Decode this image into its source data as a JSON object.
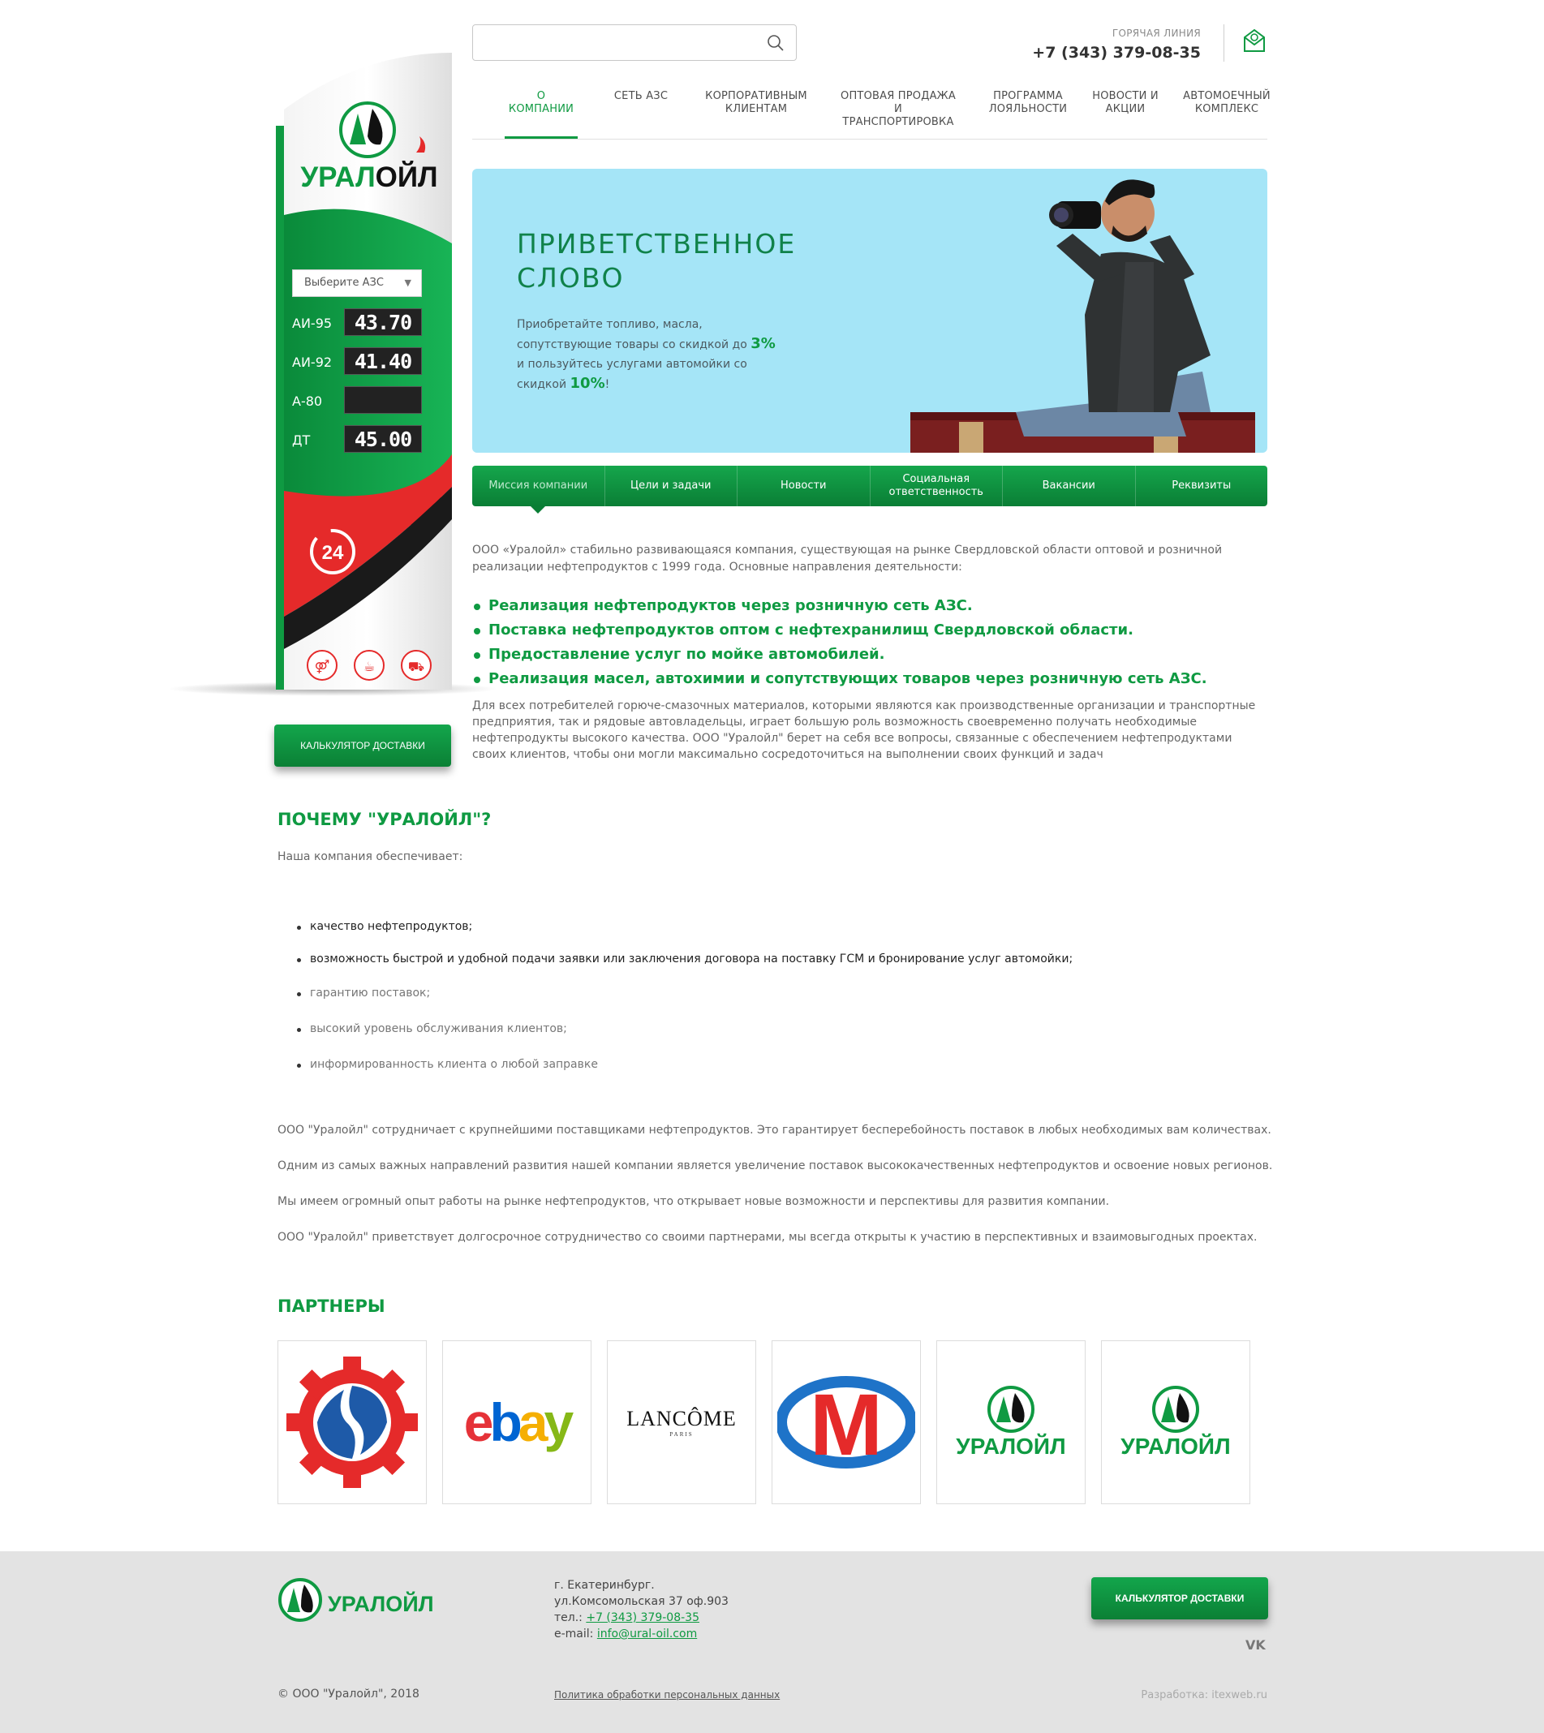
{
  "header": {
    "search_placeholder": "",
    "hotline_label": "ГОРЯЧАЯ ЛИНИЯ",
    "hotline_phone": "+7 (343) 379-08-35"
  },
  "nav": {
    "items": [
      {
        "label": "О КОМПАНИИ"
      },
      {
        "label": "СЕТЬ АЗС"
      },
      {
        "label": "КОРПОРАТИВНЫМ КЛИЕНТАМ"
      },
      {
        "label": "ОПТОВАЯ ПРОДАЖА И ТРАНСПОРТИРОВКА"
      },
      {
        "label": "ПРОГРАММА ЛОЯЛЬНОСТИ"
      },
      {
        "label": "НОВОСТИ И АКЦИИ"
      },
      {
        "label": "АВТОМОЕЧНЫЙ КОМПЛЕКС"
      }
    ]
  },
  "stela": {
    "brand": "УРАЛОЙЛ",
    "select_placeholder": "Выберите АЗС",
    "fuels": [
      {
        "name": "АИ-95",
        "price": "43.70"
      },
      {
        "name": "АИ-92",
        "price": "41.40"
      },
      {
        "name": "А-80",
        "price": ""
      },
      {
        "name": "ДТ",
        "price": "45.00"
      }
    ],
    "badge_24": "24",
    "calc_button": "КАЛЬКУЛЯТОР ДОСТАВКИ"
  },
  "hero": {
    "title_line1": "ПРИВЕТСТВЕННОЕ",
    "title_line2": "СЛОВО",
    "text_part1": "Приобретайте топливо, масла, сопутствующие товары со скидкой до",
    "discount1": "3%",
    "text_part2": "и пользуйтесь услугами автомойки со скидкой",
    "discount2": "10%",
    "text_end": "!"
  },
  "tabs": [
    {
      "label": "Миссия компании"
    },
    {
      "label": "Цели и задачи"
    },
    {
      "label": "Новости"
    },
    {
      "label": "Социальная ответственность"
    },
    {
      "label": "Вакансии"
    },
    {
      "label": "Реквизиты"
    }
  ],
  "mission": {
    "intro": "ООО «Уралойл» стабильно развивающаяся компания, существующая на рынке Свердловской области оптовой и розничной реализации нефтепродуктов с 1999 года. Основные направления деятельности:",
    "items": [
      "Реализация нефтепродуктов через розничную сеть АЗС.",
      "Поставка нефтепродуктов оптом с нефтехранилищ Свердловской области.",
      "Предоставление услуг по мойке автомобилей.",
      "Реализация масел, автохимии и сопутствующих товаров через розничную сеть АЗС."
    ],
    "body": "Для всех потребителей горюче-смазочных материалов, которыми являются как производственные организации и транспортные предприятия, так и рядовые автовладельцы, играет большую роль возможность своевременно получать необходимые нефтепродукты высокого качества. ООО \"Уралойл\" берет на себя все вопросы, связанные с обеспечением нефтепродуктами своих клиентов, чтобы они могли максимально сосредоточиться на выполнении своих функций и задач"
  },
  "why": {
    "title": "ПОЧЕМУ \"УРАЛОЙЛ\"?",
    "intro": "Наша компания обеспечивает:",
    "items": [
      "качество нефтепродуктов;",
      "возможность быстрой и удобной подачи заявки или заключения договора на поставку ГСМ и бронирование услуг автомойки;",
      "гарантию поставок;",
      "высокий уровень обслуживания клиентов;",
      "информированность клиента о любой заправке"
    ],
    "paragraphs": [
      "ООО \"Уралойл\" сотрудничает с крупнейшими поставщиками нефтепродуктов. Это гарантирует бесперебойность поставок в любых необходимых вам количествах.",
      "Одним из самых важных направлений развития нашей компании является увеличение поставок высококачественных нефтепродуктов и освоение новых регионов.",
      "Мы имеем огромный опыт работы на рынке нефтепродуктов, что открывает новые возможности и перспективы для развития компании.",
      "ООО \"Уралойл\" приветствует долгосрочное сотрудничество со своими партнерами, мы всегда открыты к участию в перспективных и взаимовыгодных проектах."
    ]
  },
  "partners": {
    "title": "ПАРТНЕРЫ",
    "ebay": "ebay",
    "lancome": "LANCÔME",
    "lancome_sub": "PARIS",
    "metro": "M",
    "uraloil": "УРАЛОЙЛ"
  },
  "footer": {
    "brand": "УРАЛОЙЛ",
    "city": "г. Екатеринбург.",
    "street": "ул.Комсомольская 37 оф.903",
    "phone_label": "тел.:",
    "phone": "+7 (343) 379-08-35",
    "email_label": "e-mail:",
    "email": "info@ural-oil.com",
    "calc_button": "КАЛЬКУЛЯТОР ДОСТАВКИ",
    "vk": "VK",
    "copyright": "© ООО \"Уралойл\", 2018",
    "privacy": "Политика обработки персональных данных",
    "developer": "Разработка: itexweb.ru"
  },
  "colors": {
    "brand_green": "#0f9a42",
    "accent_red": "#e52a2a",
    "hero_bg": "#a5e5f7",
    "footer_bg": "#e3e3e3"
  }
}
